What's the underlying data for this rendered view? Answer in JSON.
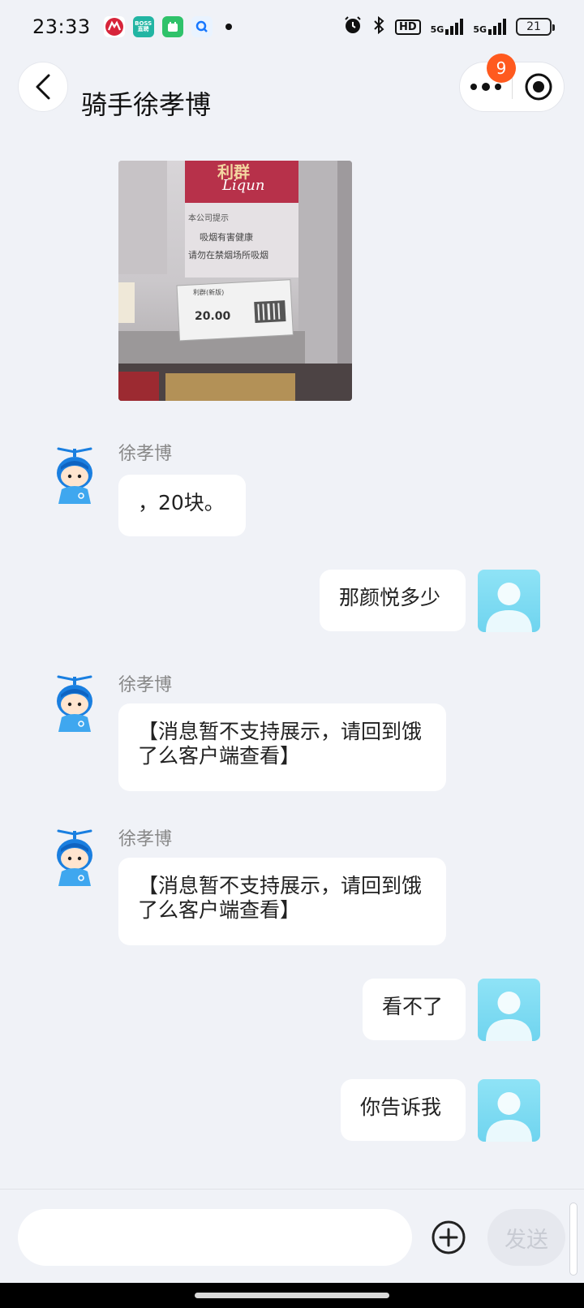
{
  "status_bar": {
    "time": "23:33",
    "app_icons": [
      "unionpay-icon",
      "boss-zhipin-icon",
      "green-shop-icon",
      "search-app-icon"
    ],
    "boss_label": "BOSS\n直聘",
    "network_hd": "HD",
    "signal1": "5G",
    "signal2": "5G",
    "battery": "21"
  },
  "header": {
    "title": "骑手徐孝博",
    "notification_count": "9"
  },
  "photo": {
    "brand_cn": "利群",
    "brand_en": "Liqun",
    "notice_line1": "本公司提示",
    "notice_line2": "吸烟有害健康",
    "notice_line3": "请勿在禁烟场所吸烟",
    "price_tag_name": "利群(新版)",
    "price_tag_price": "20.00"
  },
  "messages": [
    {
      "from": "rider",
      "name": "徐孝博",
      "text": "，20块。"
    },
    {
      "from": "me",
      "text": "那颜悦多少"
    },
    {
      "from": "rider",
      "name": "徐孝博",
      "text": "【消息暂不支持展示，请回到饿了么客户端查看】"
    },
    {
      "from": "rider",
      "name": "徐孝博",
      "text": "【消息暂不支持展示，请回到饿了么客户端查看】"
    },
    {
      "from": "me",
      "text": "看不了"
    },
    {
      "from": "me",
      "text": "你告诉我"
    }
  ],
  "input_bar": {
    "placeholder": "",
    "send_label": "发送"
  },
  "colors": {
    "background": "#f0f2f7",
    "badge": "#ff5a1f",
    "user_avatar": "#7bd9f2",
    "bot_avatar_primary": "#1b8ee8"
  }
}
